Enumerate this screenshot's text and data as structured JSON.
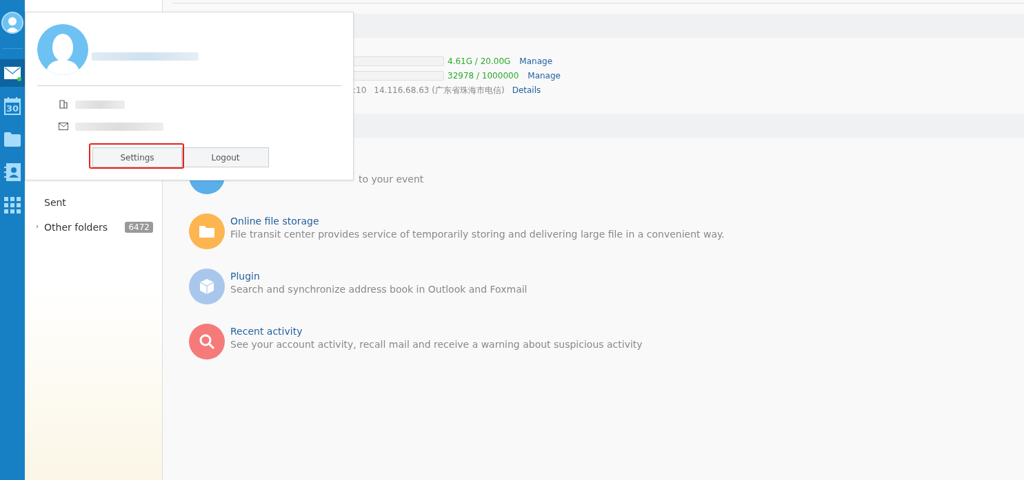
{
  "nav_rail": {
    "items": [
      {
        "kind": "mail",
        "selected": true,
        "unread": true
      },
      {
        "kind": "calendar",
        "label": "30",
        "selected": false,
        "unread": false
      },
      {
        "kind": "folder",
        "selected": false,
        "unread": false
      },
      {
        "kind": "contacts",
        "selected": false,
        "unread": false
      },
      {
        "kind": "apps",
        "selected": false,
        "unread": false
      }
    ]
  },
  "folders": [
    {
      "name": "Sent"
    },
    {
      "caret": "›",
      "name": "Other folders",
      "count": "6472"
    }
  ],
  "account_info": {
    "rows": [
      {
        "kind": "quota",
        "usage": "4.61G / 20.00G",
        "link": "Manage"
      },
      {
        "kind": "quota",
        "usage": "32978 / 1000000",
        "link": "Manage"
      },
      {
        "kind": "login",
        "time": ":10",
        "ip": "14.116.68.63 (广东省珠海市电信)",
        "link": "Details"
      }
    ]
  },
  "features": [
    {
      "kind": "event",
      "description": "to your event"
    },
    {
      "kind": "folder",
      "title": "Online file storage",
      "description": "File transit center provides service of temporarily storing and delivering large file in a convenient way."
    },
    {
      "kind": "box",
      "title": "Plugin",
      "description": "Search and synchronize address book in Outlook and Foxmail"
    },
    {
      "kind": "search",
      "title": "Recent activity",
      "description": "See your account activity, recall mail and receive a warning about suspicious activity"
    }
  ],
  "profile_popup": {
    "buttons": [
      {
        "label": "Settings",
        "highlighted": true
      },
      {
        "label": "Logout",
        "highlighted": false
      }
    ]
  }
}
